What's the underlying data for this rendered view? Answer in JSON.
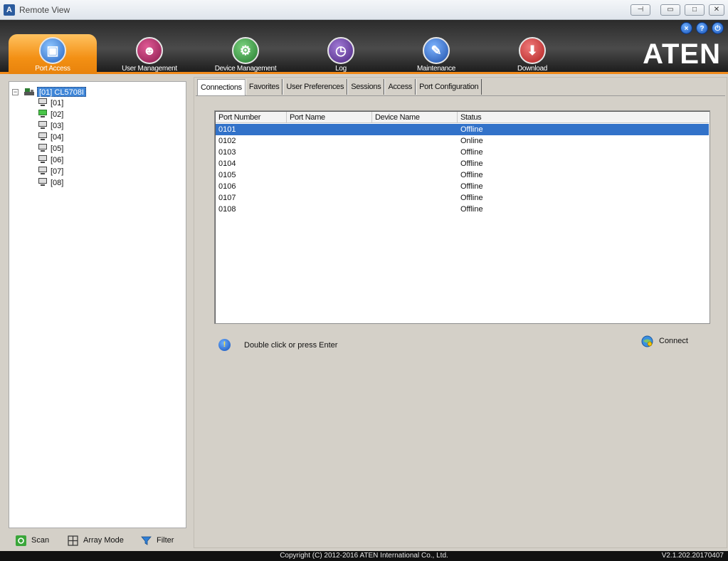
{
  "window": {
    "title": "Remote View",
    "icon": "aten-app-icon",
    "buttons": [
      "pin",
      "minimize",
      "maximize",
      "close"
    ],
    "mod_buttons": [
      "close-icon",
      "help-icon",
      "power-icon"
    ]
  },
  "toolbar": {
    "items": [
      {
        "label": "Port Access",
        "icon": "monitor-icon",
        "active": true,
        "color": "#f39014"
      },
      {
        "label": "User Management",
        "icon": "users-icon",
        "active": false,
        "color": "#9b1f57"
      },
      {
        "label": "Device Management",
        "icon": "device-icon",
        "active": false,
        "color": "#2d8f38"
      },
      {
        "label": "Log",
        "icon": "log-icon",
        "active": false,
        "color": "#5b2f8c"
      },
      {
        "label": "Maintenance",
        "icon": "maintenance-icon",
        "active": false,
        "color": "#2258b5"
      },
      {
        "label": "Download",
        "icon": "download-icon",
        "active": false,
        "color": "#c42a2a"
      }
    ],
    "brand": "ATEN"
  },
  "tree": {
    "root": "[01] CL5708I",
    "children": [
      "[01]",
      "[02]",
      "[03]",
      "[04]",
      "[05]",
      "[06]",
      "[07]",
      "[08]"
    ],
    "online_child": "[02]"
  },
  "bottom": {
    "scan": "Scan",
    "array_mode": "Array Mode",
    "filter": "Filter"
  },
  "tabs": [
    "Connections",
    "Favorites",
    "User Preferences",
    "Sessions",
    "Access",
    "Port Configuration"
  ],
  "active_tab": "Connections",
  "table": {
    "columns": [
      "Port Number",
      "Port Name",
      "Device Name",
      "Status"
    ],
    "rows": [
      {
        "port": "0101",
        "name": "",
        "device": "",
        "status": "Offline",
        "selected": true
      },
      {
        "port": "0102",
        "name": "",
        "device": "",
        "status": "Online",
        "selected": false
      },
      {
        "port": "0103",
        "name": "",
        "device": "",
        "status": "Offline",
        "selected": false
      },
      {
        "port": "0104",
        "name": "",
        "device": "",
        "status": "Offline",
        "selected": false
      },
      {
        "port": "0105",
        "name": "",
        "device": "",
        "status": "Offline",
        "selected": false
      },
      {
        "port": "0106",
        "name": "",
        "device": "",
        "status": "Offline",
        "selected": false
      },
      {
        "port": "0107",
        "name": "",
        "device": "",
        "status": "Offline",
        "selected": false
      },
      {
        "port": "0108",
        "name": "",
        "device": "",
        "status": "Offline",
        "selected": false
      }
    ]
  },
  "hint": "Double click or press Enter",
  "connect_label": "Connect",
  "status": {
    "copyright": "Copyright (C) 2012-2016 ATEN International Co., Ltd.",
    "version": "V2.1.202.20170407"
  }
}
